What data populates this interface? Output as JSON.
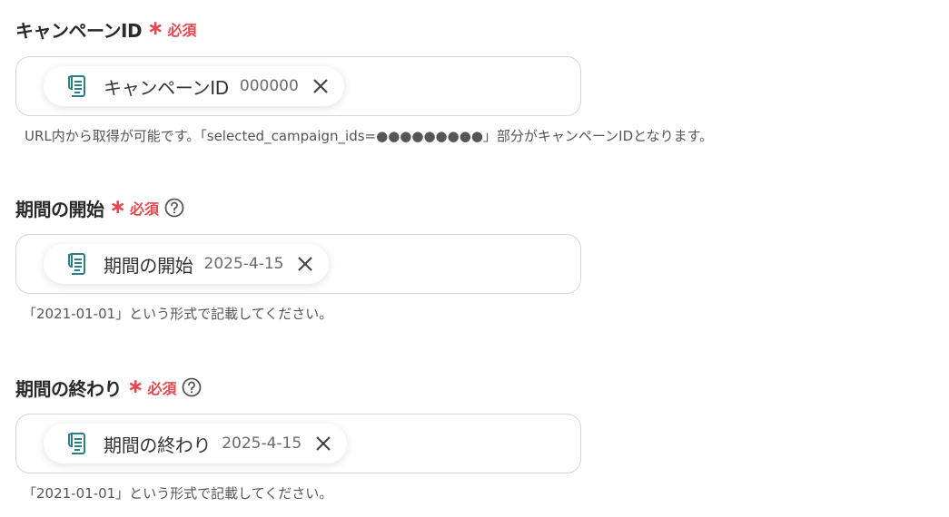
{
  "fields": [
    {
      "label": "キャンペーンID",
      "required": "必須",
      "has_help": false,
      "chip_name": "キャンペーンID",
      "chip_value": "000000",
      "hint": "URL内から取得が可能です。「selected_campaign_ids=●●●●●●●●●」部分がキャンペーンIDとなります。"
    },
    {
      "label": "期間の開始",
      "required": "必須",
      "has_help": true,
      "chip_name": "期間の開始",
      "chip_value": "2025-4-15",
      "hint": "「2021-01-01」という形式で記載してください。"
    },
    {
      "label": "期間の終わり",
      "required": "必須",
      "has_help": true,
      "chip_name": "期間の終わり",
      "chip_value": "2025-4-15",
      "hint": "「2021-01-01」という形式で記載してください。"
    }
  ],
  "colors": {
    "required": "#e8474f",
    "icon_teal": "#2a7f86",
    "border": "#d6d6d6"
  },
  "icons": {
    "chip": "document-list-icon",
    "close": "close-icon",
    "help": "question-circle-icon"
  }
}
